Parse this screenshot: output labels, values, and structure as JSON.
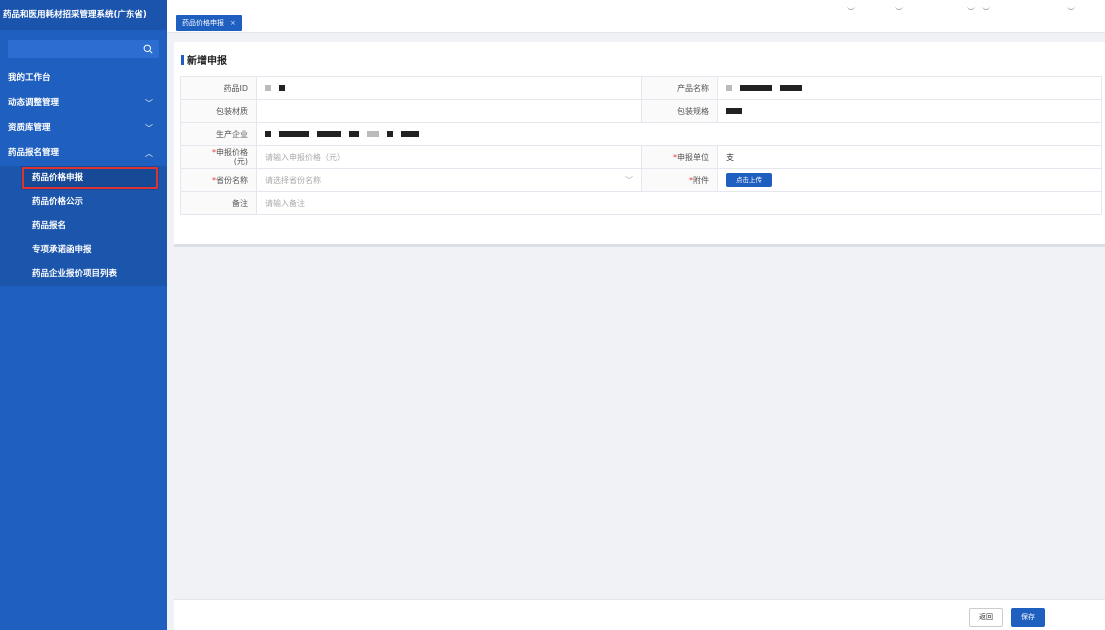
{
  "app": {
    "title": "药品和医用耗材招采管理系统(广东省)"
  },
  "search": {
    "placeholder": ""
  },
  "sidebar": {
    "items": [
      {
        "label": "我的工作台"
      },
      {
        "label": "动态调整管理",
        "chevron": "﹀"
      },
      {
        "label": "资质库管理",
        "chevron": "﹀"
      },
      {
        "label": "药品报名管理",
        "chevron": "︿"
      }
    ],
    "subitems": [
      {
        "label": "药品价格申报"
      },
      {
        "label": "药品价格公示"
      },
      {
        "label": "药品报名"
      },
      {
        "label": "专项承诺函申报"
      },
      {
        "label": "药品企业报价项目列表"
      }
    ]
  },
  "tabs": [
    {
      "label": "药品价格申报",
      "close": "×"
    }
  ],
  "section": {
    "title": "新增申报"
  },
  "form": {
    "drug_id_label": "药品ID",
    "product_name_label": "产品名称",
    "packaging_material_label": "包装材质",
    "packaging_spec_label": "包装规格",
    "manufacturer_label": "生产企业",
    "price_label_line1": "申报价格",
    "price_label_line2": "(元)",
    "price_placeholder": "请输入申报价格（元）",
    "unit_label": "申报单位",
    "unit_value": "支",
    "province_label": "省份名称",
    "province_placeholder": "请选择省份名称",
    "attachment_label": "附件",
    "upload_button": "点击上传",
    "remark_label": "备注",
    "remark_placeholder": "请输入备注",
    "required_mark": "*",
    "select_arrow": "﹀"
  },
  "footer": {
    "back_label": "返回",
    "save_label": "保存"
  },
  "colors": {
    "sidebar": "#1f5fbf",
    "accent": "#1f5fbf",
    "required": "#e33333",
    "highlight": "#d33333"
  }
}
